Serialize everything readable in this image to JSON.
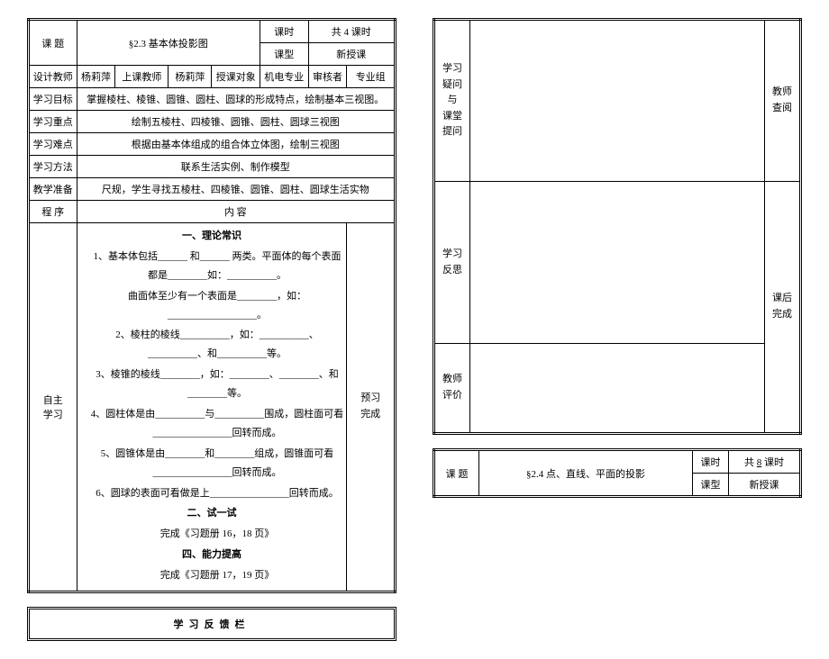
{
  "left": {
    "header": {
      "topic_label": "课  题",
      "topic_value": "§2.3 基本体投影图",
      "period_label": "课时",
      "period_value": "共  4  课时",
      "type_label": "课型",
      "type_value": "新授课"
    },
    "meta": {
      "designer_label": "设计教师",
      "designer_value": "杨莉萍",
      "lecturer_label": "上课教师",
      "lecturer_value": "杨莉萍",
      "audience_label": "授课对象",
      "audience_value": "机电专业",
      "reviewer_label": "审核者",
      "reviewer_value": "专业组"
    },
    "rows": {
      "goal_label": "学习目标",
      "goal_value": "掌握棱柱、棱锥、圆锥、圆柱、圆球的形成特点，绘制基本三视图。",
      "keypoint_label": "学习重点",
      "keypoint_value": "绘制五棱柱、四棱锥、圆锥、圆柱、圆球三视图",
      "difficulty_label": "学习难点",
      "difficulty_value": "根据由基本体组成的组合体立体图，绘制三视图",
      "method_label": "学习方法",
      "method_value": "联系生活实例、制作模型",
      "prep_label": "教学准备",
      "prep_value": "尺规，学生寻找五棱柱、四棱锥、圆锥、圆柱、圆球生活实物"
    },
    "proc": {
      "seq_label": "程  序",
      "content_label": "内  容",
      "self_study_label": "自主\n学习",
      "section1": "一、理论常识",
      "line1": "1、基本体包括______ 和______ 两类。平面体的每个表面都是________如：__________。",
      "line2": "曲面体至少有一个表面是________，如：__________________。",
      "line3": "2、棱柱的棱线__________，如：__________、__________、和__________等。",
      "line4": "3、棱锥的棱线________，如：________、________、和________等。",
      "line5": "4、圆柱体是由__________与__________围成，圆柱面可看________________回转而成。",
      "line6": "5、圆锥体是由________和________组成，圆锥面可看________________回转而成。",
      "line7": "6、圆球的表面可看做是上________________回转而成。",
      "section2": "二、试一试",
      "line8": "完成《习题册 16，18 页》",
      "section3": "四、能力提高",
      "line9": "完成《习题册 17，19 页》",
      "preview_label": "预习\n完成"
    },
    "feedback_title": "学习反馈栏"
  },
  "right": {
    "col1_label1": "学习\n疑问\n与\n课堂\n提问",
    "col2_label1": "教师\n查阅",
    "col1_label2": "学习\n反思",
    "col2_label2": "课后\n完成",
    "col1_label3": "教师\n评价",
    "header2": {
      "topic_label": "课  题",
      "topic_value": "§2.4 点、直线、平面的投影",
      "period_label": "课时",
      "period_value_pre": "共",
      "period_value_num": "8",
      "period_value_suf": "课时",
      "type_label": "课型",
      "type_value": "新授课"
    }
  }
}
